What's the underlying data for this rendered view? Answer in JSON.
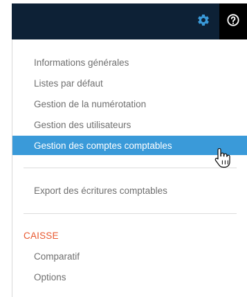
{
  "header": {
    "settings_icon": "gear-icon",
    "help_icon": "question-circle-icon",
    "accent_active": "#3a9ad9",
    "bar_color": "#0d2136"
  },
  "menu": {
    "group1": [
      "Informations générales",
      "Listes par défaut",
      "Gestion de la numérotation",
      "Gestion des utilisateurs",
      "Gestion des comptes comptables"
    ],
    "active_index": 4,
    "group2": [
      "Export des écritures comptables"
    ],
    "section_title": "CAISSE",
    "section_title_color": "#e8572e",
    "group3": [
      "Comparatif",
      "Options"
    ]
  },
  "cursor_icon": "hand-pointer-icon"
}
